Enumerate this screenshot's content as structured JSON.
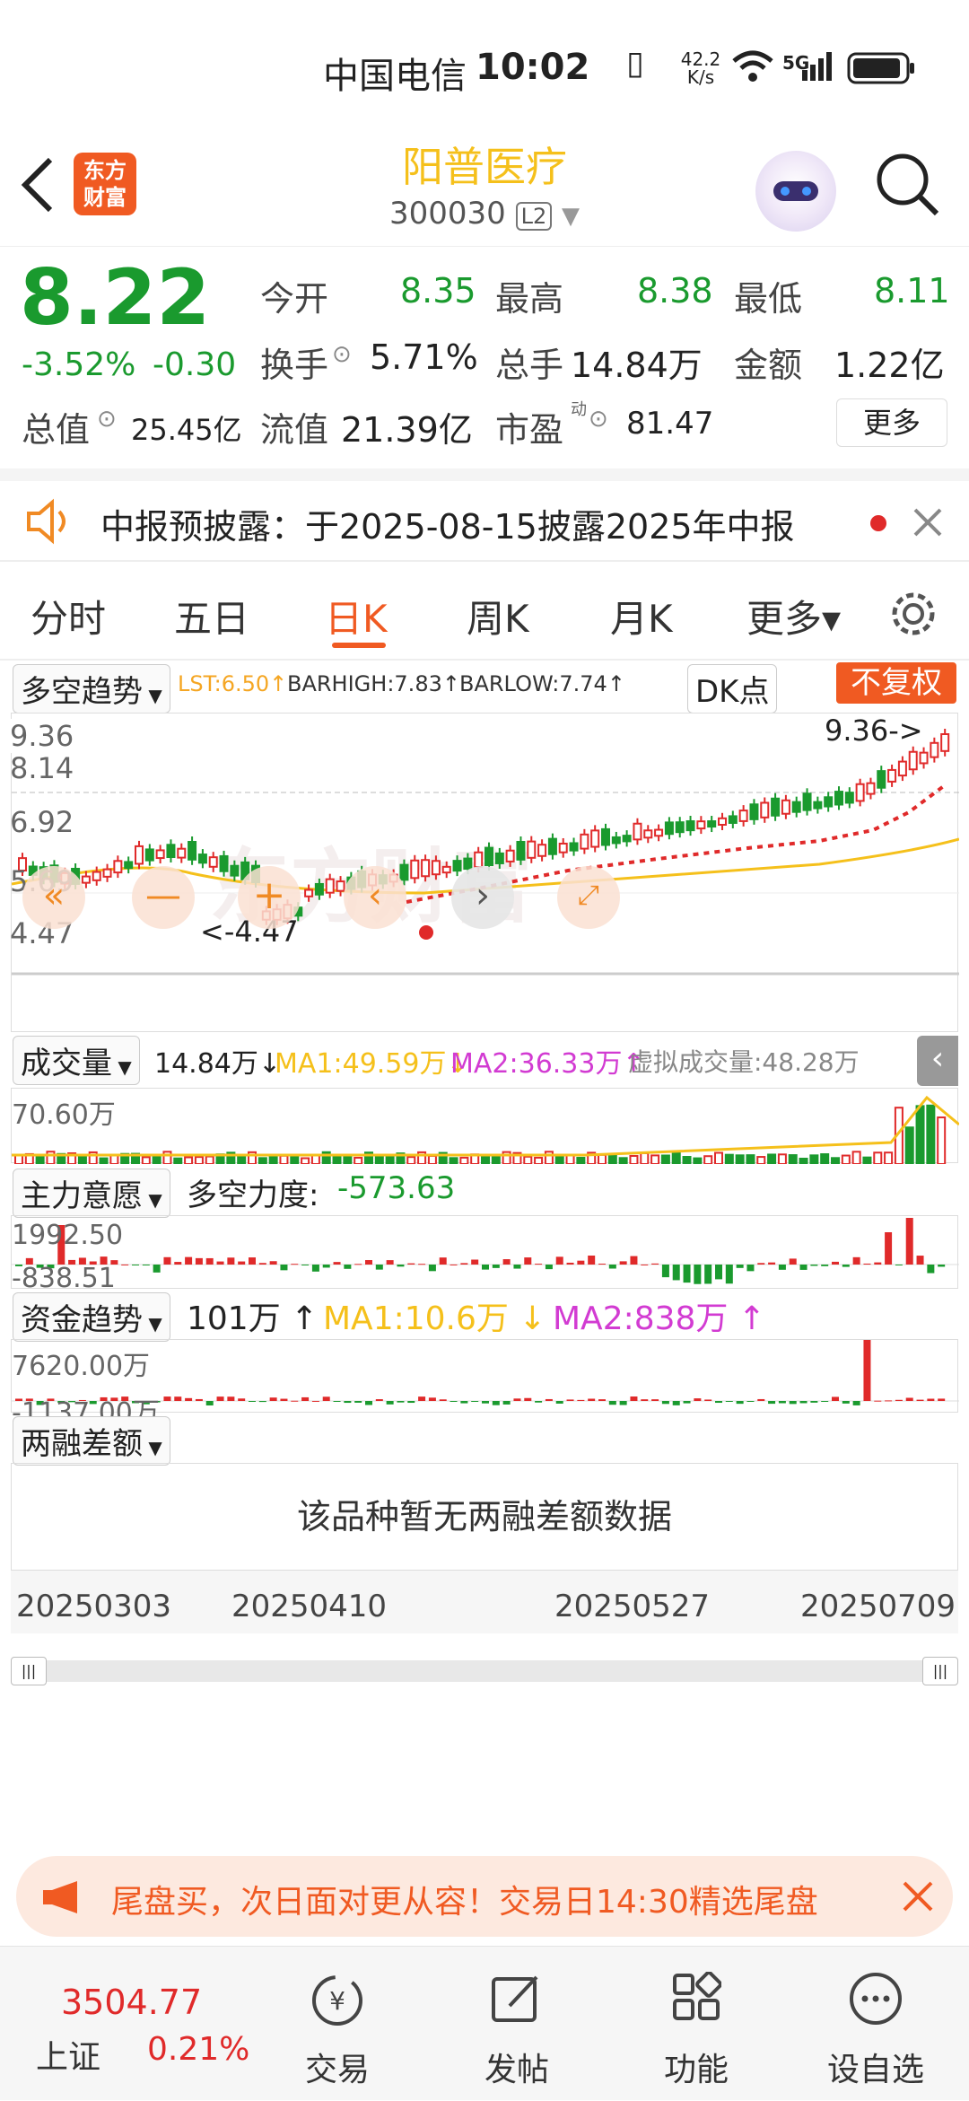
{
  "status_bar": {
    "carrier": "中国电信",
    "time": "10:02",
    "net_speed_top": "42.2",
    "net_speed_bottom": "K/s",
    "net_type": "5G"
  },
  "header": {
    "logo_text": "东方\n财富",
    "stock_name": "阳普医疗",
    "stock_code": "300030",
    "level_badge": "L2"
  },
  "quote": {
    "price": "8.22",
    "change_pct": "-3.52%",
    "change_abs": "-0.30",
    "open_label": "今开",
    "open": "8.35",
    "high_label": "最高",
    "high": "8.38",
    "low_label": "最低",
    "low": "8.11",
    "turnover_label": "换手",
    "turnover": "5.71%",
    "volume_label": "总手",
    "volume": "14.84万",
    "amount_label": "金额",
    "amount": "1.22亿",
    "mktcap_label": "总值",
    "mktcap": "25.45亿",
    "float_label": "流值",
    "float_cap": "21.39亿",
    "pe_label": "市盈",
    "pe_sup": "动",
    "pe": "81.47",
    "more_button": "更多"
  },
  "notice": {
    "text": "中报预披露：于2025-08-15披露2025年中报"
  },
  "tabs": [
    {
      "label": "分时"
    },
    {
      "label": "五日"
    },
    {
      "label": "日K"
    },
    {
      "label": "周K"
    },
    {
      "label": "月K"
    },
    {
      "label": "更多▾"
    }
  ],
  "kline": {
    "indicator_select": "多空趋势",
    "lst": "LST:6.50↑",
    "barhigh": "BARHIGH:7.83↑",
    "barlow": "BARLOW:7.74↑",
    "dk_button": "DK点",
    "adjust_button": "不复权",
    "y_max": "9.36",
    "y_2": "8.14",
    "y_3": "6.92",
    "y_4": "5.69",
    "y_min": "4.47",
    "high_marker": "9.36->",
    "low_marker": "<-4.47",
    "watermark": "东方财富"
  },
  "volume_panel": {
    "select": "成交量",
    "value": "14.84万↓",
    "ma1": "MA1:49.59万↓",
    "ma2": "MA2:36.33万↑",
    "virtual": "虚拟成交量:48.28万",
    "y_max": "70.60万"
  },
  "force_panel": {
    "select": "主力意愿",
    "label": "多空力度:",
    "value": "-573.63",
    "y_max": "1992.50",
    "y_min": "-838.51"
  },
  "fund_panel": {
    "select": "资金趋势",
    "value": "101万 ↑",
    "ma1": "MA1:10.6万 ↓",
    "ma2": "MA2:838万 ↑",
    "y_max": "7620.00万",
    "y_min": "-1137.00万"
  },
  "margin_panel": {
    "select": "两融差额",
    "empty_text": "该品种暂无两融差额数据"
  },
  "dates": {
    "d1": "20250303",
    "d2": "20250410",
    "d3": "20250527",
    "d4": "20250709"
  },
  "banner": {
    "text": "尾盘买，次日面对更从容！交易日14:30精选尾盘"
  },
  "bottom_nav": {
    "index_value": "3504.77",
    "index_name": "上证",
    "index_change": "0.21%",
    "items": [
      {
        "label": "交易"
      },
      {
        "label": "发帖"
      },
      {
        "label": "功能"
      },
      {
        "label": "设自选"
      }
    ]
  },
  "colors": {
    "up": "#e02a2a",
    "down": "#1a9a2e",
    "accent": "#f08a24",
    "stock_name": "#f5c01b"
  }
}
